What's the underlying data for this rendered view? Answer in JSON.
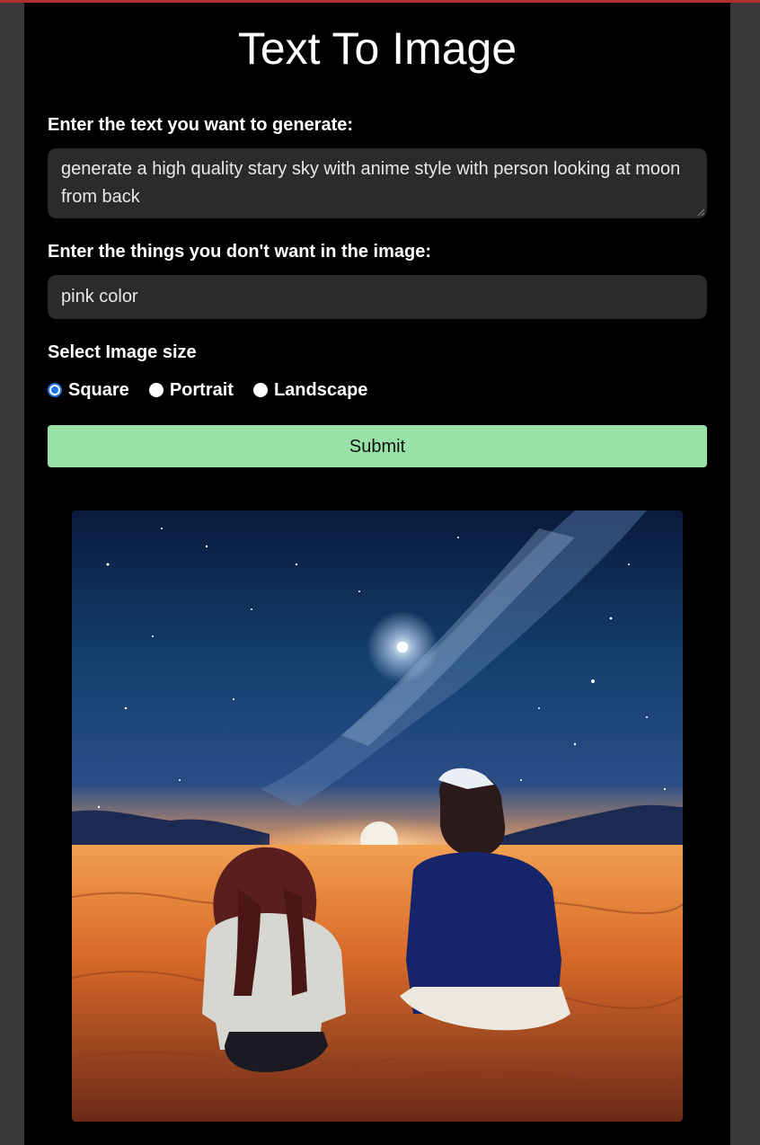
{
  "page": {
    "title": "Text To Image"
  },
  "form": {
    "prompt_label": "Enter the text you want to generate:",
    "prompt_value": "generate a high quality stary sky with anime style with person looking at moon from back",
    "negative_label": "Enter the things you don't want in the image:",
    "negative_value": "pink color",
    "size_label": "Select Image size",
    "size_options": [
      "Square",
      "Portrait",
      "Landscape"
    ],
    "size_selected": "Square",
    "submit_label": "Submit"
  },
  "colors": {
    "background": "#000000",
    "input_bg": "#2b2b2b",
    "submit_bg": "#98e2a8",
    "radio_accent": "#1a73e8"
  }
}
